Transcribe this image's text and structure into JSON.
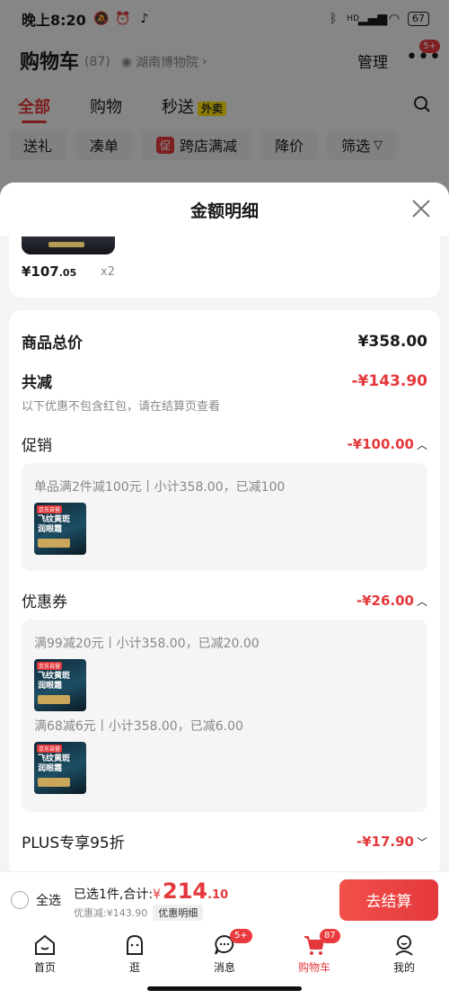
{
  "status_bar": {
    "time": "晚上8:20",
    "battery": "67",
    "signal_label": "HD"
  },
  "header": {
    "title": "购物车",
    "count": "(87)",
    "location": "湖南博物院",
    "manage": "管理",
    "more_badge": "5+"
  },
  "tabs": [
    {
      "label": "全部"
    },
    {
      "label": "购物"
    },
    {
      "label": "秒送",
      "tag": "外卖"
    }
  ],
  "filters": {
    "gift": "送礼",
    "combine": "凑单",
    "promo_tag": "促",
    "cross_store": "跨店满减",
    "price_drop": "降价",
    "filter": "筛选"
  },
  "sheet": {
    "title": "金额明细",
    "product": {
      "price_int": "¥107",
      "price_dec": ".05",
      "qty": "x2"
    },
    "total_label": "商品总价",
    "total_value": "¥358.00",
    "reduce_label": "共减",
    "reduce_value": "-¥143.90",
    "note": "以下优惠不包含红包，请在结算页查看",
    "promo_label": "促销",
    "promo_value": "-¥100.00",
    "promo_line": "单品满2件减100元丨小计358.00，已减100",
    "coupon_label": "优惠券",
    "coupon_value": "-¥26.00",
    "coupon_line1": "满99减20元丨小计358.00，已减20.00",
    "coupon_line2": "满68减6元丨小计358.00，已减6.00",
    "plus_label": "PLUS专享95折",
    "plus_value": "-¥17.90",
    "thumb_tag": "京东自营",
    "thumb_text": "飞纹黄斑\n润眼霜"
  },
  "bottom_bar": {
    "select_all": "全选",
    "selected": "已选1件,合计:",
    "yen": "¥",
    "total_int": "214",
    "total_dec": ".10",
    "discount": "优惠减:¥143.90",
    "detail_btn": "优惠明细",
    "checkout": "去结算"
  },
  "nav": [
    {
      "label": "首页",
      "icon": "home-icon"
    },
    {
      "label": "逛",
      "icon": "face-icon"
    },
    {
      "label": "消息",
      "icon": "message-icon",
      "badge": "5+"
    },
    {
      "label": "购物车",
      "icon": "cart-icon",
      "badge": "87"
    },
    {
      "label": "我的",
      "icon": "profile-icon"
    }
  ],
  "colors": {
    "accent": "#e4393c",
    "overlay": "rgba(0,0,0,0.45)"
  }
}
